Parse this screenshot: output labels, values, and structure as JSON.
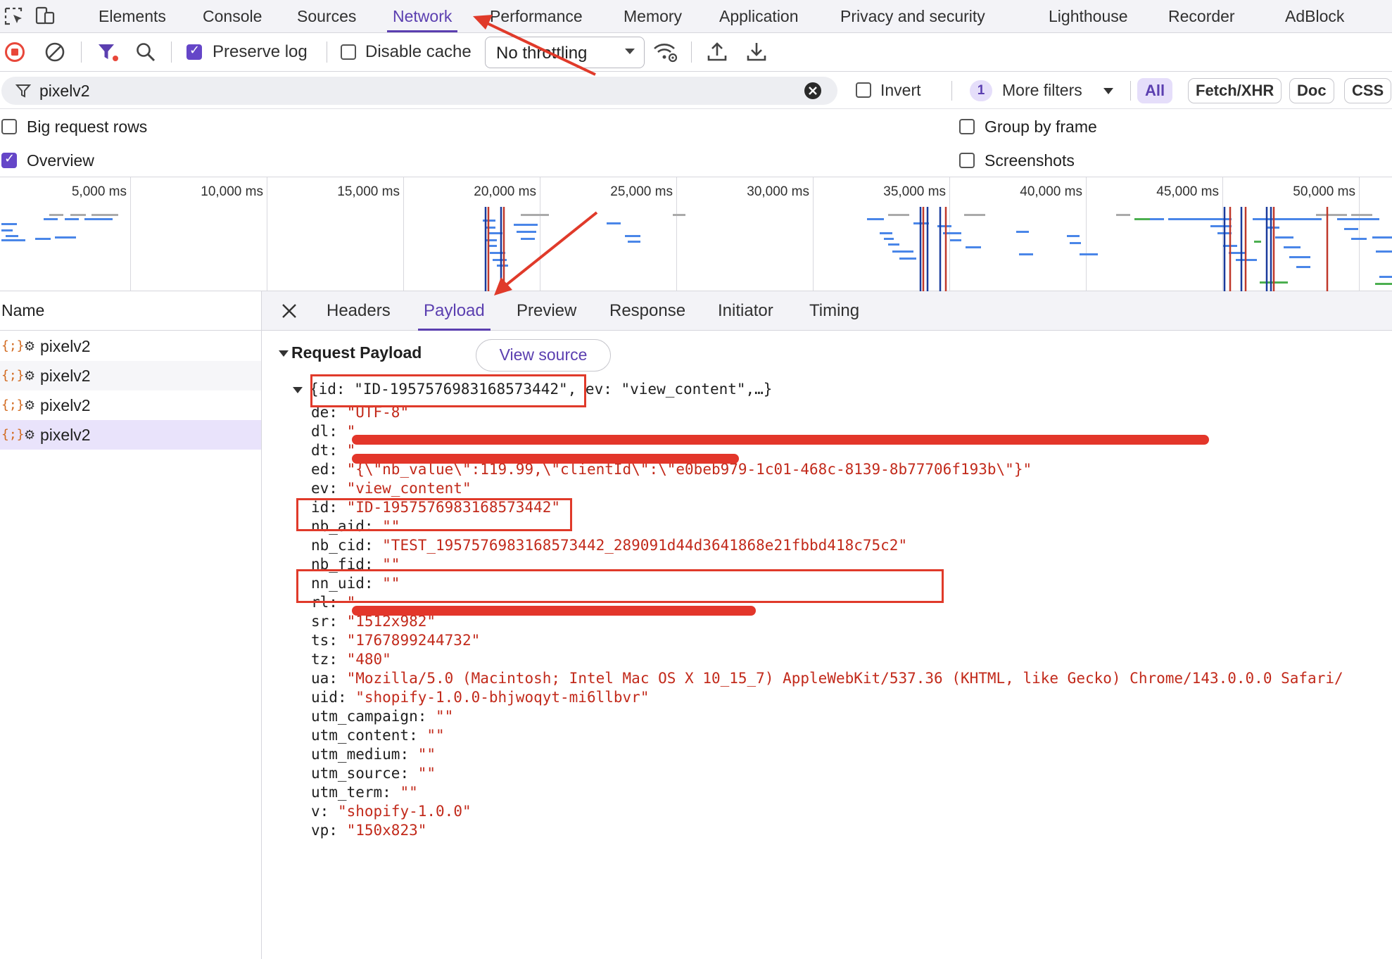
{
  "tabs": [
    "Elements",
    "Console",
    "Sources",
    "Network",
    "Performance",
    "Memory",
    "Application",
    "Privacy and security",
    "Lighthouse",
    "Recorder",
    "AdBlock"
  ],
  "active_tab": "Network",
  "toolbar": {
    "preserve_log": "Preserve log",
    "disable_cache": "Disable cache",
    "throttling": "No throttling"
  },
  "filter": {
    "value": "pixelv2",
    "invert": "Invert",
    "more_filters_count": "1",
    "more_filters": "More filters",
    "type_pills": [
      "All",
      "Fetch/XHR",
      "Doc",
      "CSS"
    ]
  },
  "options": {
    "big_request_rows": "Big request rows",
    "group_by_frame": "Group by frame",
    "overview": "Overview",
    "screenshots": "Screenshots"
  },
  "overview_ticks": [
    "5,000 ms",
    "10,000 ms",
    "15,000 ms",
    "20,000 ms",
    "25,000 ms",
    "30,000 ms",
    "35,000 ms",
    "40,000 ms",
    "45,000 ms",
    "50,000 ms"
  ],
  "list": {
    "header": "Name",
    "icon_text": "{;}",
    "rows": [
      "pixelv2",
      "pixelv2",
      "pixelv2",
      "pixelv2"
    ]
  },
  "detail": {
    "tabs": [
      "Headers",
      "Payload",
      "Preview",
      "Response",
      "Initiator",
      "Timing"
    ],
    "active_tab": "Payload",
    "section_title": "Request Payload",
    "view_source": "View source",
    "summary": "{id: \"ID-1957576983168573442\", ev: \"view_content\",…}",
    "payload": [
      {
        "k": "de",
        "v": "\"UTF-8\""
      },
      {
        "k": "dl",
        "v": "\""
      },
      {
        "k": "dt",
        "v": "\""
      },
      {
        "k": "ed",
        "v": "\"{\\\"nb_value\\\":119.99,\\\"clientId\\\":\\\"e0beb979-1c01-468c-8139-8b77706f193b\\\"}\""
      },
      {
        "k": "ev",
        "v": "\"view_content\""
      },
      {
        "k": "id",
        "v": "\"ID-1957576983168573442\""
      },
      {
        "k": "nb_aid",
        "v": "\"\""
      },
      {
        "k": "nb_cid",
        "v": "\"TEST_1957576983168573442_289091d44d3641868e21fbbd418c75c2\""
      },
      {
        "k": "nb_fid",
        "v": "\"\""
      },
      {
        "k": "nn_uid",
        "v": "\"\""
      },
      {
        "k": "rl",
        "v": "\""
      },
      {
        "k": "sr",
        "v": "\"1512x982\""
      },
      {
        "k": "ts",
        "v": "\"1767899244732\""
      },
      {
        "k": "tz",
        "v": "\"480\""
      },
      {
        "k": "ua",
        "v": "\"Mozilla/5.0 (Macintosh; Intel Mac OS X 10_15_7) AppleWebKit/537.36 (KHTML, like Gecko) Chrome/143.0.0.0 Safari/"
      },
      {
        "k": "uid",
        "v": "\"shopify-1.0.0-bhjwoqyt-mi6llbvr\""
      },
      {
        "k": "utm_campaign",
        "v": "\"\""
      },
      {
        "k": "utm_content",
        "v": "\"\""
      },
      {
        "k": "utm_medium",
        "v": "\"\""
      },
      {
        "k": "utm_source",
        "v": "\"\""
      },
      {
        "k": "utm_term",
        "v": "\"\""
      },
      {
        "k": "v",
        "v": "\"shopify-1.0.0\""
      },
      {
        "k": "vp",
        "v": "\"150x823\""
      }
    ]
  },
  "colors": {
    "accent": "#5b3fb0",
    "annotation_red": "#e03a2a",
    "value_red": "#c22a1b",
    "record_red": "#e8473a"
  }
}
